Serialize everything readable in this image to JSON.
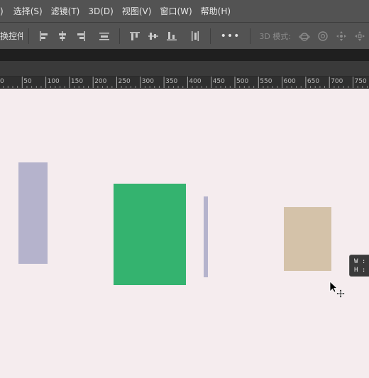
{
  "menu": [
    {
      "id": "paren",
      "label": ")"
    },
    {
      "id": "select",
      "label": "选择(S)"
    },
    {
      "id": "filter",
      "label": "滤镜(T)"
    },
    {
      "id": "3d",
      "label": "3D(D)"
    },
    {
      "id": "view",
      "label": "视图(V)"
    },
    {
      "id": "window",
      "label": "窗口(W)"
    },
    {
      "id": "help",
      "label": "帮助(H)"
    }
  ],
  "options": {
    "transform_controls_label": "换控件",
    "more_label": "•••",
    "mode_3d_label": "3D 模式:"
  },
  "ruler": {
    "labels": [
      "0",
      "50",
      "100",
      "150",
      "200",
      "250",
      "300",
      "350",
      "400",
      "450",
      "500",
      "550",
      "600",
      "650",
      "700",
      "750"
    ]
  },
  "canvas": {
    "background": "#f5ecee",
    "shapes": [
      {
        "name": "rect-lavender-left",
        "color": "#b5b3cc"
      },
      {
        "name": "rect-green",
        "color": "#34b36f"
      },
      {
        "name": "rect-lavender-thin",
        "color": "#b5b3cc"
      },
      {
        "name": "rect-tan",
        "color": "#d4c2a9"
      }
    ]
  },
  "tooltip": {
    "w_label": "W :",
    "h_label": "H :"
  },
  "cursor": {
    "icon": "move-cursor-icon"
  }
}
